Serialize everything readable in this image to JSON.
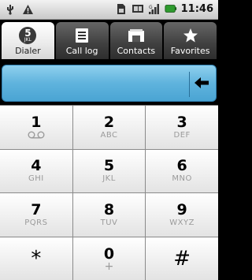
{
  "status_bar": {
    "left_icons": [
      "usb-icon",
      "warning-icon"
    ],
    "right_icons": [
      "sim-icon",
      "battery-alt-icon",
      "signal-icon",
      "battery-icon"
    ],
    "time": "11:46"
  },
  "tabs": [
    {
      "label": "Dialer",
      "icon": "dialer-icon",
      "badge_digit": "5",
      "badge_letters": "JKL",
      "active": true
    },
    {
      "label": "Call log",
      "icon": "call-log-icon",
      "active": false
    },
    {
      "label": "Contacts",
      "icon": "contacts-icon",
      "active": false
    },
    {
      "label": "Favorites",
      "icon": "star-icon",
      "active": false
    }
  ],
  "display": {
    "digits": "",
    "delete_icon": "backspace-arrow-icon"
  },
  "keypad": [
    {
      "digit": "1",
      "letters": "",
      "sub_icon": "voicemail-icon"
    },
    {
      "digit": "2",
      "letters": "ABC"
    },
    {
      "digit": "3",
      "letters": "DEF"
    },
    {
      "digit": "4",
      "letters": "GHI"
    },
    {
      "digit": "5",
      "letters": "JKL"
    },
    {
      "digit": "6",
      "letters": "MNO"
    },
    {
      "digit": "7",
      "letters": "PQRS"
    },
    {
      "digit": "8",
      "letters": "TUV"
    },
    {
      "digit": "9",
      "letters": "WXYZ"
    },
    {
      "digit": "*",
      "letters": ""
    },
    {
      "digit": "0",
      "letters": "+"
    },
    {
      "digit": "#",
      "letters": ""
    }
  ],
  "colors": {
    "display_blue": "#5fb3dd",
    "active_tab": "#ffffff",
    "inactive_tab": "#3f3f3f"
  }
}
